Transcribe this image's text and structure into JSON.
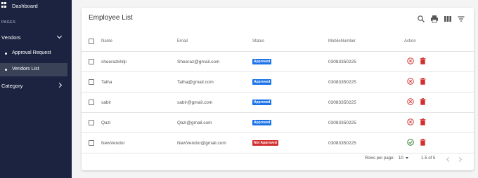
{
  "sidebar": {
    "dashboard_label": "Dashboard",
    "section_label": "PAGES",
    "vendors_label": "Vendors",
    "sub_items": [
      {
        "label": "Approval Request"
      },
      {
        "label": "Vendors List"
      }
    ],
    "category_label": "Category"
  },
  "card": {
    "title": "Employee List",
    "toolbar": [
      "search-icon",
      "print-icon",
      "columns-icon",
      "filter-icon"
    ]
  },
  "table": {
    "headers": {
      "name": "Name",
      "email": "Email",
      "status": "Status",
      "mobile": "MobileNumber",
      "action": "Action"
    },
    "rows": [
      {
        "name": "sheerazkhilji",
        "email": "Sheeraz@gmail.com",
        "status": "Approved",
        "mobile": "03083350225",
        "action": "reject"
      },
      {
        "name": "Talha",
        "email": "Talha@gmail.com",
        "status": "Approved",
        "mobile": "03083350225",
        "action": "reject"
      },
      {
        "name": "sabir",
        "email": "sabir@gmail.com",
        "status": "Approved",
        "mobile": "03083350225",
        "action": "reject"
      },
      {
        "name": "Qazi",
        "email": "Qazi@gmail.com",
        "status": "Approved",
        "mobile": "03083350225",
        "action": "reject"
      },
      {
        "name": "NewVendor",
        "email": "NewVendor@gmail.com",
        "status": "Not Approved",
        "mobile": "03083350225",
        "action": "approve"
      }
    ]
  },
  "pagination": {
    "rows_label": "Rows per page:",
    "rows_value": "10",
    "range": "1-5 of 5"
  },
  "colors": {
    "sidebar": "#1b2340",
    "approved": "#1a73e8",
    "not_approved": "#d32f2f",
    "delete": "#d32f2f",
    "approve_check": "#2e7d32"
  }
}
